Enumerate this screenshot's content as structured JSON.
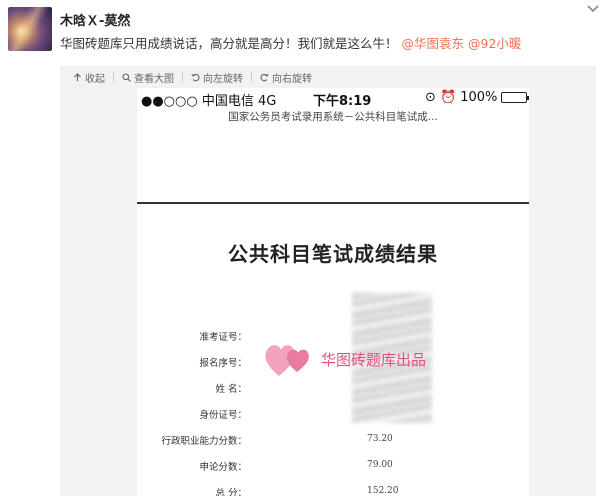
{
  "post": {
    "username": "木晗Ｘ-莫然",
    "text": "华图砖题库只用成绩说话，高分就是高分！我们就是这么牛！",
    "mentions": [
      "@华图袁东",
      "@92小暖"
    ]
  },
  "toolbar": {
    "items": [
      {
        "label": "收起",
        "icon": "collapse-icon"
      },
      {
        "label": "查看大图",
        "icon": "magnify-icon"
      },
      {
        "label": "向左旋转",
        "icon": "rotate-left-icon"
      },
      {
        "label": "向右旋转",
        "icon": "rotate-right-icon"
      }
    ]
  },
  "phone": {
    "carrier": "●●○○○ 中国电信  4G",
    "time": "下午8:19",
    "battery_icons": "⊙ ⏰",
    "battery_pct": "100%",
    "system_title": "国家公务员考试录用系统－公共科目笔试成...",
    "result_title": "公共科目笔试成绩结果",
    "fields": [
      {
        "label": "准考证号：",
        "value": ""
      },
      {
        "label": "报名序号：",
        "value": ""
      },
      {
        "label": "姓 名：",
        "value": ""
      },
      {
        "label": "身份证号：",
        "value": ""
      },
      {
        "label": "行政职业能力分数：",
        "value": "73.20"
      },
      {
        "label": "申论分数：",
        "value": "79.00"
      },
      {
        "label": "总 分：",
        "value": "152.20"
      }
    ],
    "watermark": "华图砖题库出品"
  },
  "colors": {
    "mention": "#eb7350",
    "battery": "#28c840",
    "watermark": "#e34f7f"
  }
}
